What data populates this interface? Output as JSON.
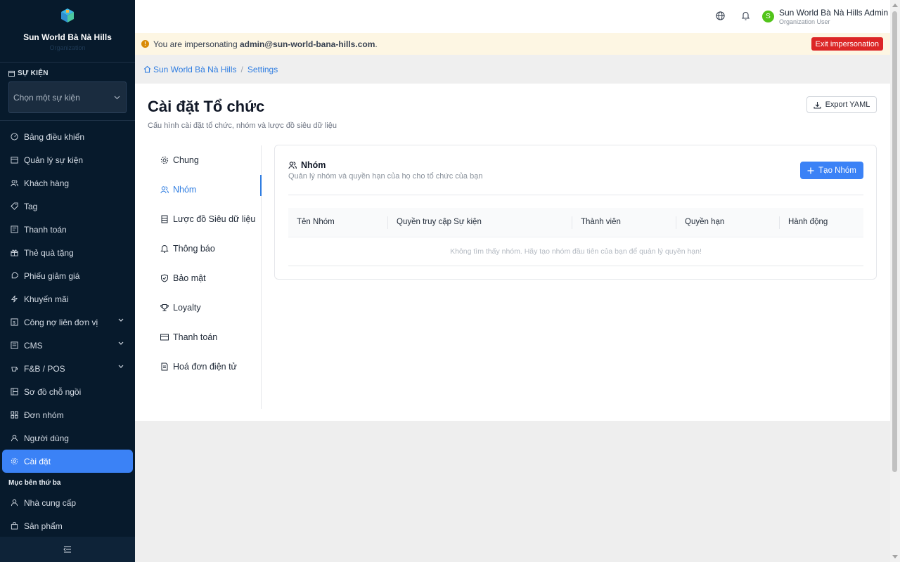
{
  "sidebar": {
    "org_name": "Sun World Bà Nà Hills",
    "org_sub": "Organization",
    "event_section_label": "SỰ KIỆN",
    "event_select_placeholder": "Chọn một sự kiện",
    "items": [
      {
        "label": "Bảng điều khiển",
        "icon": "dashboard-icon"
      },
      {
        "label": "Quản lý sự kiện",
        "icon": "calendar-icon"
      },
      {
        "label": "Khách hàng",
        "icon": "users-icon"
      },
      {
        "label": "Tag",
        "icon": "tag-icon"
      },
      {
        "label": "Thanh toán",
        "icon": "payment-icon"
      },
      {
        "label": "Thẻ quà tặng",
        "icon": "gift-icon"
      },
      {
        "label": "Phiếu giảm giá",
        "icon": "coupon-icon"
      },
      {
        "label": "Khuyến mãi",
        "icon": "bolt-icon"
      },
      {
        "label": "Công nợ liên đơn vị",
        "icon": "ledger-icon",
        "expandable": true
      },
      {
        "label": "CMS",
        "icon": "cms-icon",
        "expandable": true
      },
      {
        "label": "F&B / POS",
        "icon": "coffee-icon",
        "expandable": true
      },
      {
        "label": "Sơ đồ chỗ ngồi",
        "icon": "seat-map-icon"
      },
      {
        "label": "Đơn nhóm",
        "icon": "grid-icon"
      },
      {
        "label": "Người dùng",
        "icon": "user-icon"
      },
      {
        "label": "Cài đặt",
        "icon": "gear-icon",
        "active": true
      }
    ],
    "third_party_title": "Mục bên thứ ba",
    "third_party_items": [
      {
        "label": "Nhà cung cấp",
        "icon": "user-icon"
      },
      {
        "label": "Sản phẩm",
        "icon": "bag-icon"
      }
    ]
  },
  "topbar": {
    "user_initial": "S",
    "user_name": "Sun World Bà Nà Hills Admin",
    "user_role": "Organization User"
  },
  "banner": {
    "prefix": "You are impersonating ",
    "email": "admin@sun-world-bana-hills.com",
    "suffix": ".",
    "exit_label": "Exit impersonation"
  },
  "breadcrumb": {
    "home": "Sun World Bà Nà Hills",
    "current": "Settings"
  },
  "page": {
    "title": "Cài đặt Tổ chức",
    "subtitle": "Cấu hình cài đặt tổ chức, nhóm và lược đồ siêu dữ liệu",
    "export_label": "Export YAML"
  },
  "settings_tabs": [
    {
      "label": "Chung",
      "icon": "gear-icon"
    },
    {
      "label": "Nhóm",
      "icon": "users-icon",
      "active": true
    },
    {
      "label": "Lược đồ Siêu dữ liệu",
      "icon": "schema-icon"
    },
    {
      "label": "Thông báo",
      "icon": "bell-icon"
    },
    {
      "label": "Bảo mật",
      "icon": "shield-icon"
    },
    {
      "label": "Loyalty",
      "icon": "trophy-icon"
    },
    {
      "label": "Thanh toán",
      "icon": "card-icon"
    },
    {
      "label": "Hoá đơn điện tử",
      "icon": "invoice-icon"
    }
  ],
  "groups": {
    "title": "Nhóm",
    "subtitle": "Quản lý nhóm và quyền hạn của họ cho tổ chức của bạn",
    "create_label": "Tạo Nhóm",
    "columns": [
      "Tên Nhóm",
      "Quyền truy cập Sự kiện",
      "Thành viên",
      "Quyền hạn",
      "Hành động"
    ],
    "empty_text": "Không tìm thấy nhóm. Hãy tạo nhóm đầu tiên của bạn để quản lý quyền hạn!"
  },
  "colors": {
    "accent": "#3b82f6",
    "sidebar_bg": "#071a2c",
    "danger": "#dc2626",
    "warning": "#d98a04"
  }
}
